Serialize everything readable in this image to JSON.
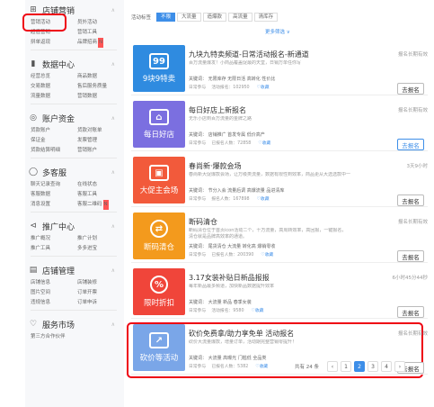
{
  "sidebar": {
    "sections": [
      {
        "icon": "store-marketing-icon",
        "title": "店铺营销",
        "items": [
          "营销活动",
          "员外活动",
          "超值营销",
          "营销工具",
          "拼单返现",
          "品牌招商"
        ],
        "new_index": 5
      },
      {
        "icon": "data-center-icon",
        "title": "数据中心",
        "items": [
          "经营总览",
          "商品数据",
          "交易数据",
          "售后服务质量",
          "流量数据",
          "营销数据"
        ]
      },
      {
        "icon": "account-funds-icon",
        "title": "账户资金",
        "items": [
          "货款账户",
          "货款对账单",
          "保证金",
          "发票管理",
          "货款结算明细",
          "营销账户"
        ]
      },
      {
        "icon": "customer-service-icon",
        "title": "多客服",
        "items": [
          "聊天记录查询",
          "在线状态",
          "客服数据",
          "客服工具",
          "消息设置",
          "客服二维码"
        ],
        "new_index": 5
      },
      {
        "icon": "promotion-icon",
        "title": "推广中心",
        "items": [
          "推广概况",
          "推广计划",
          "推广工具",
          "多多进宝"
        ]
      },
      {
        "icon": "shop-management-icon",
        "title": "店铺管理",
        "items": [
          "店铺信息",
          "店铺装修",
          "图片空间",
          "订单开票",
          "违规信息",
          "订单申诉"
        ]
      },
      {
        "icon": "service-market-icon",
        "title": "服务市场",
        "items": [
          "第三方合作伙伴"
        ]
      }
    ]
  },
  "filters": {
    "label": "活动标签",
    "chips": [
      "不限",
      "大流量",
      "造爆款",
      "高流量",
      "清库存"
    ],
    "active": 0,
    "more": "更多筛选 ∨"
  },
  "cards": [
    {
      "color": "#2f8be0",
      "symbol": "99",
      "round": false,
      "caption": "9块9特卖",
      "title": "九块九特卖频道-日常活动报名-新通道",
      "desc": "百万流量爆发！小商品覆盖促最的天堂，日销万单任你写",
      "keywords": "关键词：  无限库存  无限日活  高转化  性价比",
      "meta": "日常参与",
      "registered": "活动报名：102950",
      "fav": "收藏",
      "status": "报名长期有效",
      "button": "去报名",
      "hi": false
    },
    {
      "color": "#7b6fe0",
      "symbol": "⌂",
      "round": false,
      "caption": "每日好店",
      "title": "每日好店上新报名",
      "desc": "无乐小店到百万流量的金牌之路",
      "keywords": "关键词：  店铺推广  首发专属  低价高产",
      "meta": "日常参与",
      "registered": "已报名人数：72858",
      "fav": "收藏",
      "status": "报名长期有效",
      "button": "去报名",
      "hi": true
    },
    {
      "color": "#f25a3b",
      "symbol": "▣",
      "round": false,
      "caption": "大促主会场",
      "title": "春尚新·爆款会场",
      "desc": "春尚新大促爆款会场，让万级类流量，数据有限性到效率，商品更从大选选款中一",
      "keywords": "关键词：  节分入会  流量后调  高爆流量  品进清库",
      "meta": "日常参与",
      "registered": "报名人数：167898",
      "fav": "收藏",
      "status": "3天9小时",
      "button": "去报名",
      "hi": false
    },
    {
      "color": "#f39a1d",
      "symbol": "⇄",
      "round": true,
      "caption": "断码清仓",
      "title": "断码清仓",
      "desc": "断码清仓位于首页icon活动二个，十万流量，高周转效率，高回报，一键报名，清仓就是品牌高效率的通道。",
      "keywords": "关键词：  尾货清仓  大流量  转化高  爆销零收",
      "meta": "日常参与",
      "registered": "已报名人数：200390",
      "fav": "收藏",
      "status": "报名长期有效",
      "button": "去报名",
      "hi": false
    },
    {
      "color": "#f0453a",
      "symbol": "%",
      "round": true,
      "caption": "限时折扣",
      "title": "3.17女装补贴日新品报报",
      "desc": "每年新品最多频道，加快新品数据提升效率",
      "keywords": "关键词：  大流量  新品  春季女装",
      "meta": "日常参与",
      "registered": "活动报名：9580",
      "fav": "收藏",
      "status": "6小时45分44秒",
      "button": "去报名",
      "hi": false
    },
    {
      "color": "#7aa6e8",
      "symbol": "↗",
      "round": false,
      "caption": "砍价等活动",
      "title": "砍价免费拿/助力享免单 活动报名",
      "desc": "砍价大流量爆款，增量订单，活动期完整营销零提升！",
      "keywords": "关键词：  大流量  高曝光  门槛低  全品类",
      "meta": "日常参与",
      "registered": "已报名人数：5382",
      "fav": "收藏",
      "status": "报名长期有效",
      "button": "去报名",
      "hi": false
    }
  ],
  "pager": {
    "total": "共有 24 条",
    "prev": "‹",
    "pages": [
      "1",
      "2",
      "3",
      "4"
    ],
    "current": 1,
    "next": "›"
  }
}
